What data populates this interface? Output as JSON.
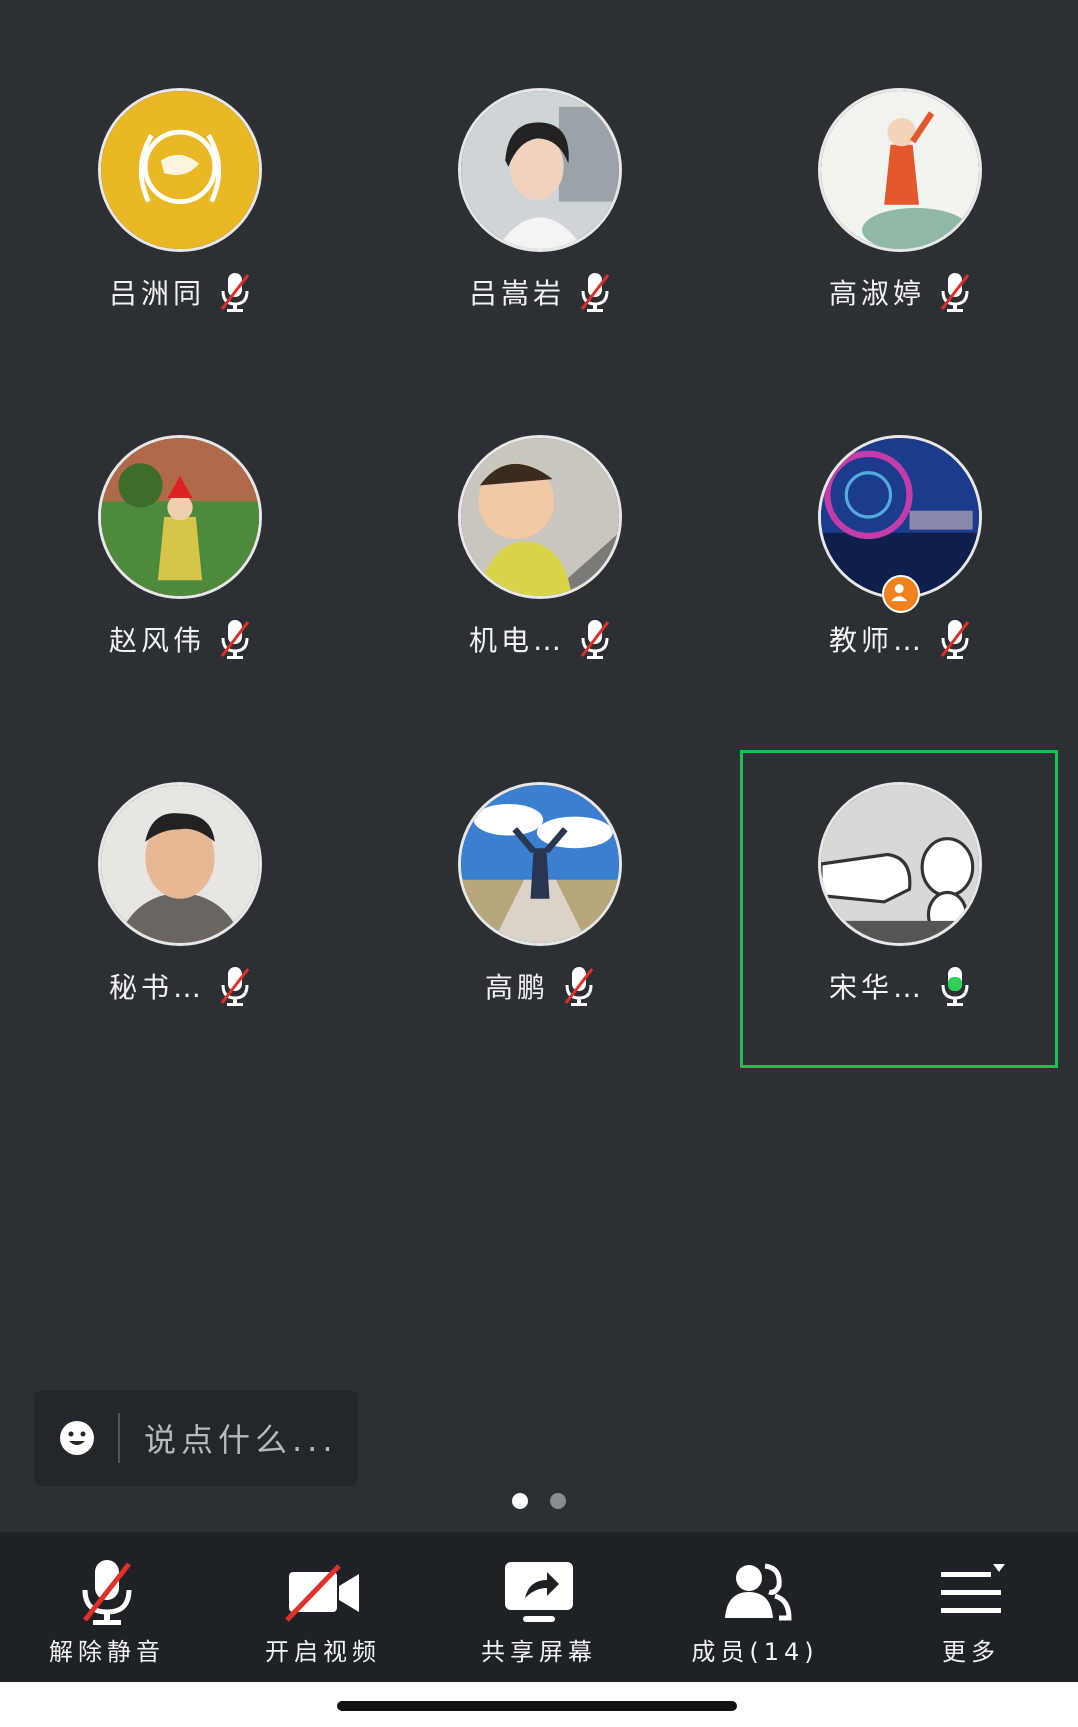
{
  "participants": [
    {
      "name": "吕洲同",
      "mic": "muted"
    },
    {
      "name": "吕嵩岩",
      "mic": "muted"
    },
    {
      "name": "高淑婷",
      "mic": "muted"
    },
    {
      "name": "赵风伟",
      "mic": "muted"
    },
    {
      "name": "机电…",
      "mic": "muted"
    },
    {
      "name": "教师…",
      "mic": "muted",
      "host": true
    },
    {
      "name": "秘书…",
      "mic": "muted"
    },
    {
      "name": "高鹏",
      "mic": "muted"
    },
    {
      "name": "宋华…",
      "mic": "active",
      "speaking": true
    }
  ],
  "chat": {
    "placeholder": "说点什么..."
  },
  "pager": {
    "pages": 2,
    "current": 1
  },
  "toolbar": {
    "unmute_label": "解除静音",
    "video_label": "开启视频",
    "share_label": "共享屏幕",
    "members_label": "成员(14)",
    "more_label": "更多"
  },
  "colors": {
    "background": "#2c2f33",
    "toolbar": "#1e2125",
    "speaking_frame": "#1fbf4f",
    "mute_slash": "#e0302a",
    "active_mic": "#2fd05a",
    "host_badge": "#f0821e"
  },
  "icons": {
    "muted_mic": "mic-off-icon",
    "active_mic": "mic-on-icon",
    "emoji": "emoji-icon",
    "video_off": "video-off-icon",
    "share_screen": "share-screen-icon",
    "members": "members-icon",
    "more": "menu-more-icon"
  }
}
